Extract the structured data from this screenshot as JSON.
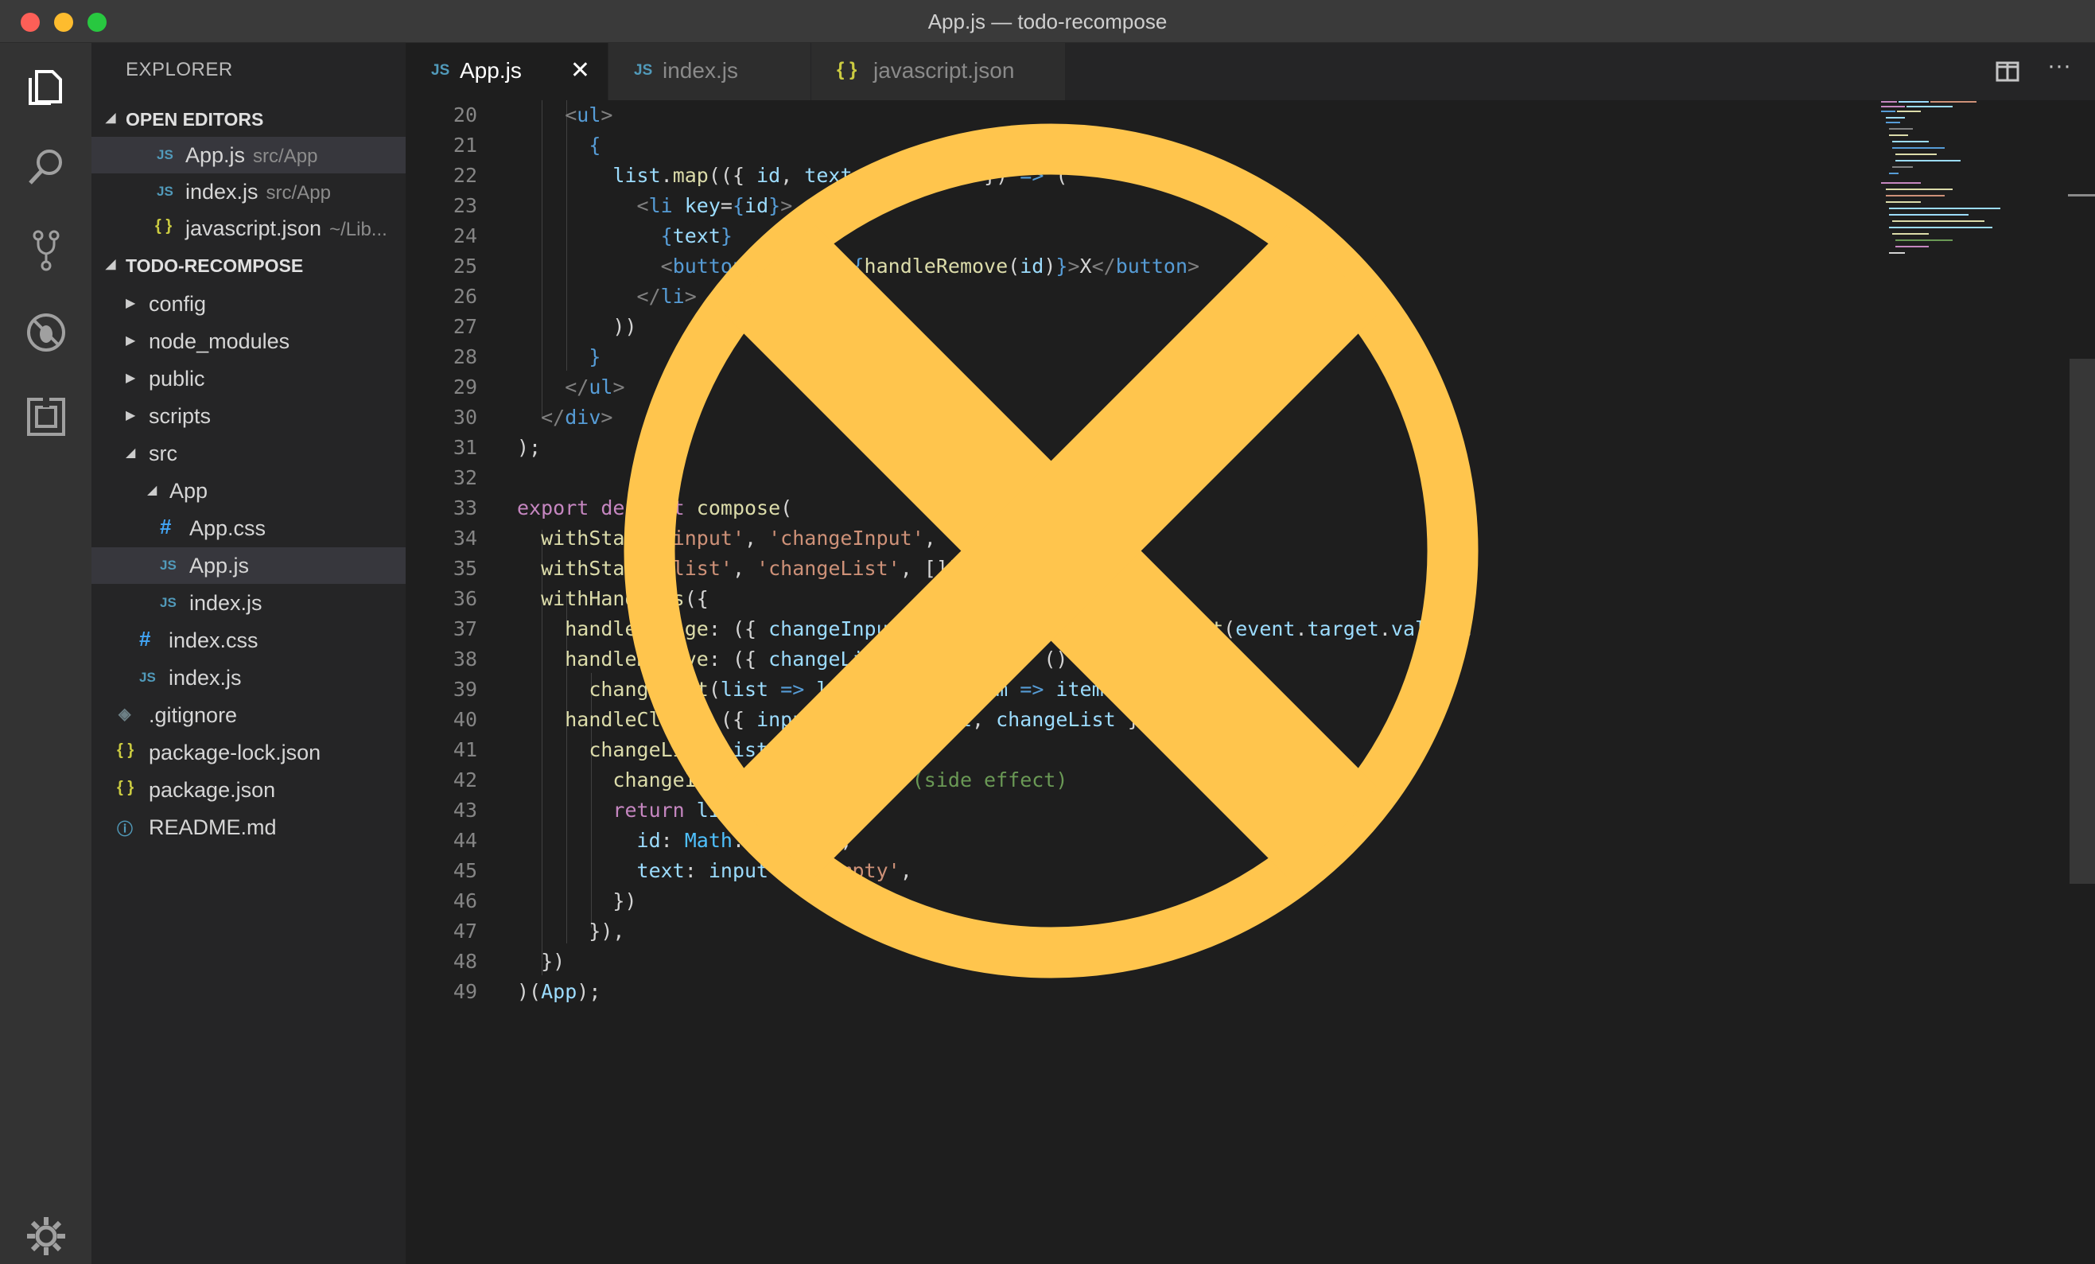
{
  "window": {
    "title": "App.js — todo-recompose"
  },
  "activity_bar": {
    "icons": [
      "files-icon",
      "search-icon",
      "source-control-icon",
      "debug-icon",
      "extensions-icon",
      "gear-icon"
    ]
  },
  "sidebar": {
    "header": "EXPLORER",
    "open_editors": {
      "title": "OPEN EDITORS",
      "items": [
        {
          "icon": "JS",
          "name": "App.js",
          "path": "src/App"
        },
        {
          "icon": "JS",
          "name": "index.js",
          "path": "src/App"
        },
        {
          "icon": "{ }",
          "name": "javascript.json",
          "path": "~/Lib..."
        }
      ]
    },
    "project": {
      "title": "TODO-RECOMPOSE",
      "items": [
        {
          "label": "config"
        },
        {
          "label": "node_modules"
        },
        {
          "label": "public"
        },
        {
          "label": "scripts"
        },
        {
          "label": "src"
        },
        {
          "label": "App"
        },
        {
          "icon": "#",
          "label": "App.css"
        },
        {
          "icon": "JS",
          "label": "App.js"
        },
        {
          "icon": "JS",
          "label": "index.js"
        },
        {
          "icon": "#",
          "label": "index.css"
        },
        {
          "icon": "JS",
          "label": "index.js"
        },
        {
          "icon": "◈",
          "label": ".gitignore"
        },
        {
          "icon": "{ }",
          "label": "package-lock.json"
        },
        {
          "icon": "{ }",
          "label": "package.json"
        },
        {
          "icon": "ⓘ",
          "label": "README.md"
        }
      ]
    }
  },
  "tabs": [
    {
      "icon": "JS",
      "label": "App.js",
      "active": true,
      "close": "✕"
    },
    {
      "icon": "JS",
      "label": "index.js",
      "active": false
    },
    {
      "icon": "{ }",
      "label": "javascript.json",
      "active": false
    }
  ],
  "editor": {
    "line_numbers": [
      "20",
      "21",
      "22",
      "23",
      "24",
      "25",
      "26",
      "27",
      "28",
      "29",
      "30",
      "31",
      "32",
      "33",
      "34",
      "35",
      "36",
      "37",
      "38",
      "39",
      "40",
      "41",
      "42",
      "43",
      "44",
      "45",
      "46",
      "47",
      "48",
      "49"
    ]
  },
  "colors": {
    "overlay": "#ffc54d",
    "accent": "#519aba",
    "background": "#1e1e1e"
  }
}
